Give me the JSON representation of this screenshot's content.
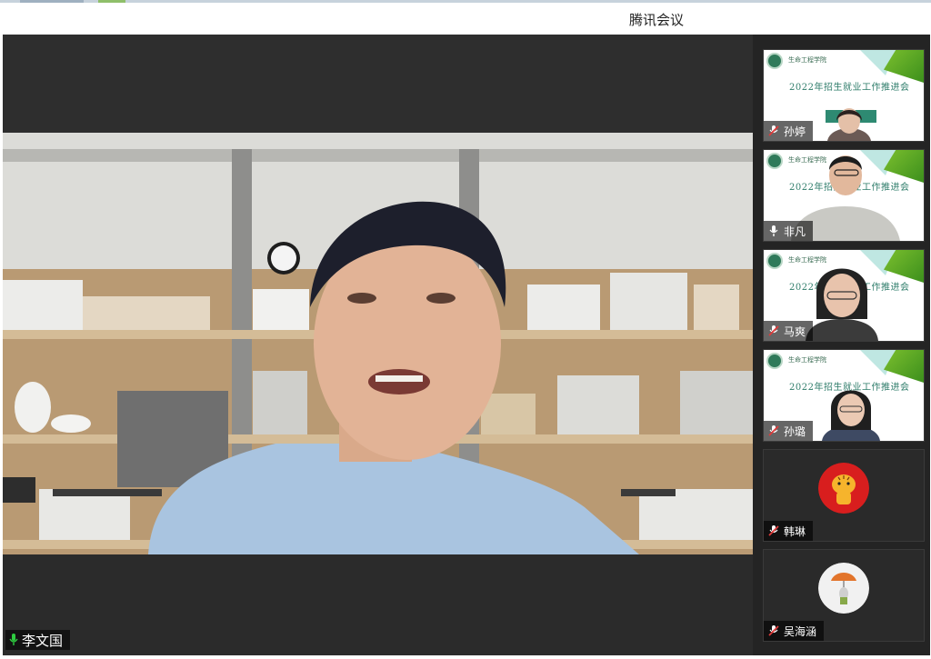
{
  "app": {
    "title": "腾讯会议"
  },
  "speaker": {
    "name": "李文国",
    "mic": "on"
  },
  "slide": {
    "college": "生命工程学院",
    "headline": "2022年招生就业工作推进会"
  },
  "participants": [
    {
      "name": "孙婷",
      "mic": "muted",
      "view": "slide-video"
    },
    {
      "name": "非凡",
      "mic": "on",
      "view": "slide-video"
    },
    {
      "name": "马爽",
      "mic": "muted",
      "view": "slide-video"
    },
    {
      "name": "孙璐",
      "mic": "muted",
      "view": "slide-video"
    },
    {
      "name": "韩琳",
      "mic": "muted",
      "view": "avatar",
      "avatar_icon": "tiger-avatar-icon"
    },
    {
      "name": "吴海涵",
      "mic": "muted",
      "view": "avatar",
      "avatar_icon": "umbrella-avatar-icon"
    }
  ],
  "colors": {
    "mic_on": "#2ecc40",
    "mic_muted": "#e03a3a",
    "brand_green": "#3c8f1c"
  }
}
